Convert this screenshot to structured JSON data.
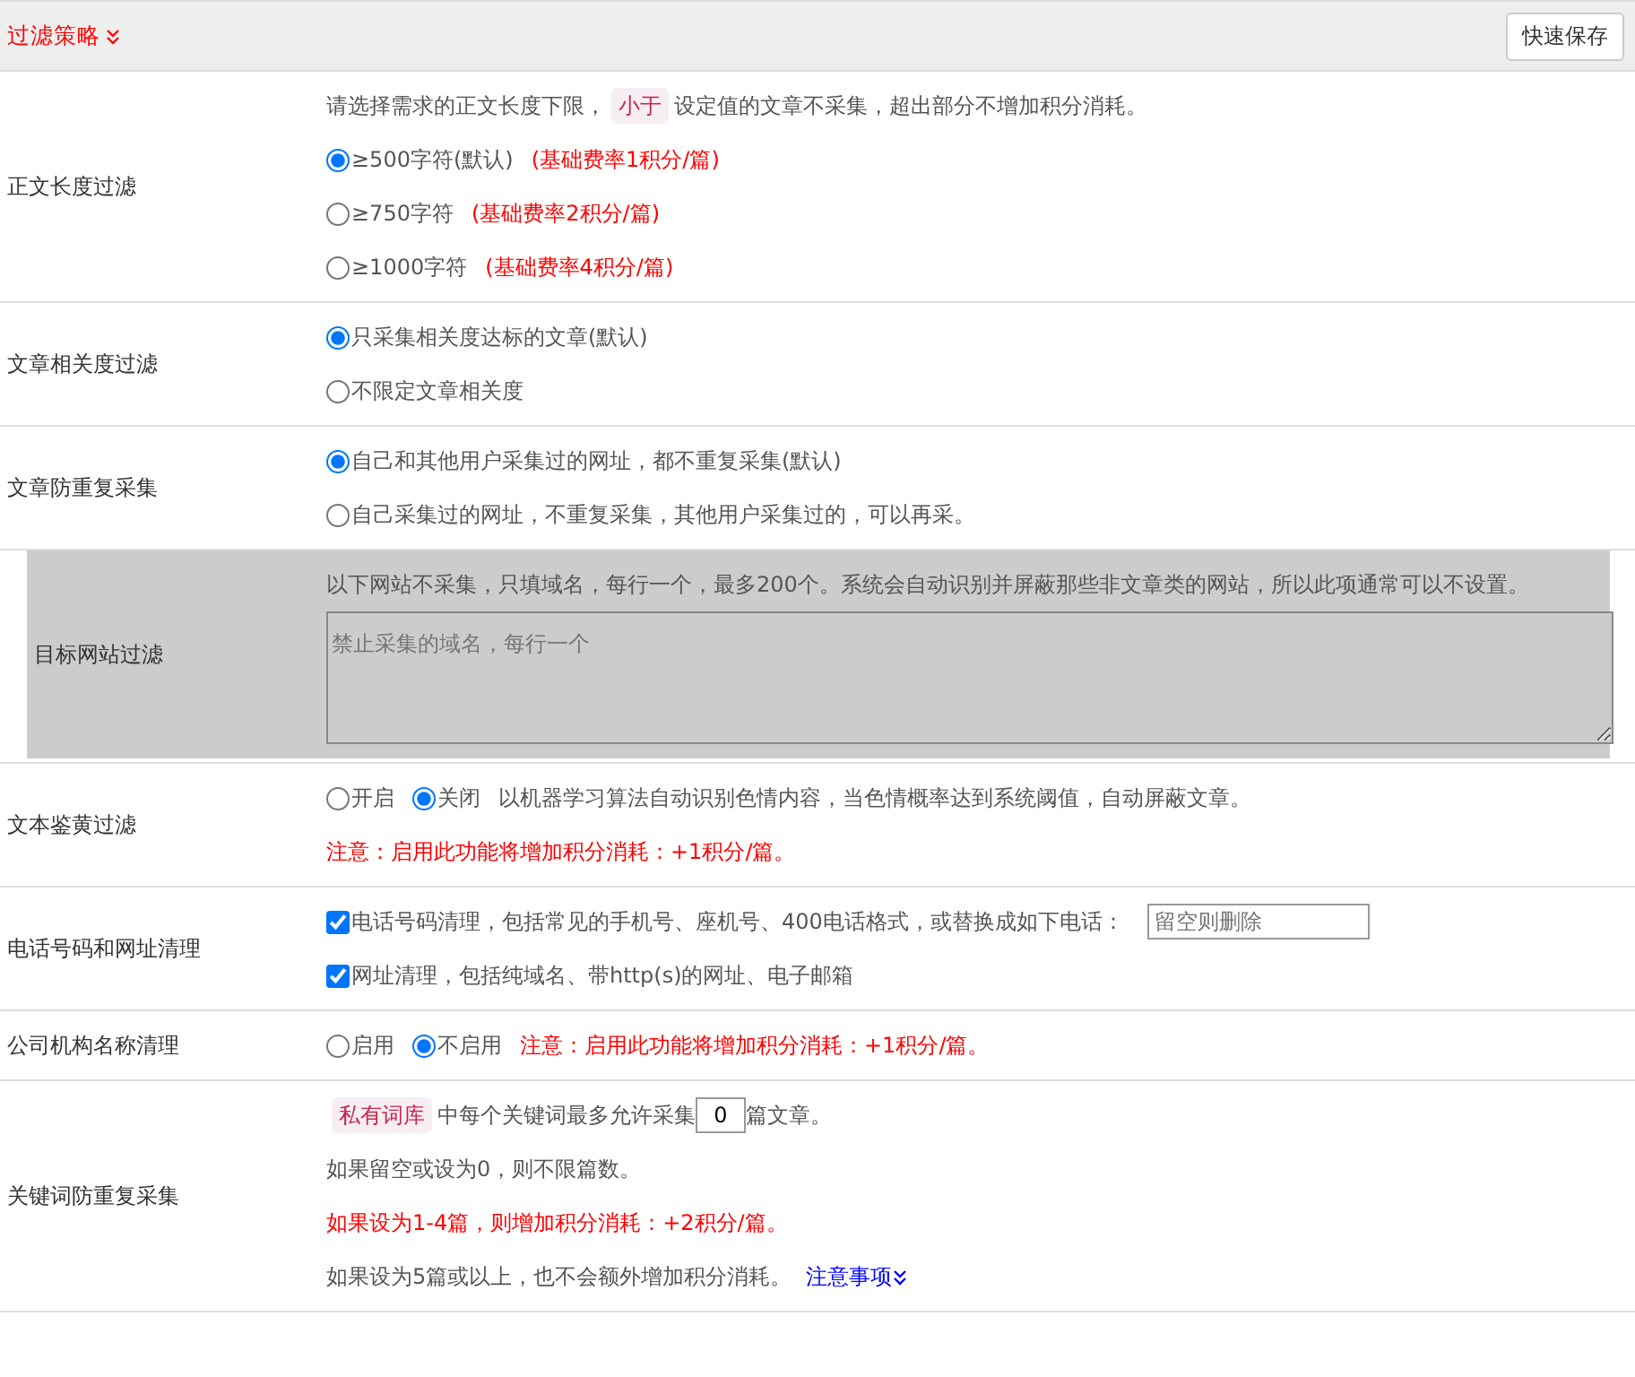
{
  "header": {
    "title": "过滤策略",
    "save_button": "快速保存"
  },
  "rows": [
    {
      "label": "正文长度过滤",
      "highlighted": false,
      "lines": [
        [
          {
            "kind": "text",
            "text": "请选择需求的正文长度下限，"
          },
          {
            "kind": "tag",
            "text": "小于"
          },
          {
            "kind": "text",
            "text": "设定值的文章不采集，超出部分不增加积分消耗。"
          }
        ],
        [
          {
            "kind": "radio",
            "text": "≥500字符(默认)",
            "selected": true
          },
          {
            "kind": "note",
            "text": "(基础费率1积分/篇)"
          }
        ],
        [
          {
            "kind": "radio",
            "text": "≥750字符",
            "selected": false
          },
          {
            "kind": "note",
            "text": "(基础费率2积分/篇)"
          }
        ],
        [
          {
            "kind": "radio",
            "text": "≥1000字符",
            "selected": false
          },
          {
            "kind": "note",
            "text": "(基础费率4积分/篇)"
          }
        ]
      ]
    },
    {
      "label": "文章相关度过滤",
      "highlighted": false,
      "lines": [
        [
          {
            "kind": "radio",
            "text": "只采集相关度达标的文章(默认)",
            "selected": true
          }
        ],
        [
          {
            "kind": "radio",
            "text": "不限定文章相关度",
            "selected": false
          }
        ]
      ]
    },
    {
      "label": "文章防重复采集",
      "highlighted": false,
      "lines": [
        [
          {
            "kind": "radio",
            "text": "自己和其他用户采集过的网址，都不重复采集(默认)",
            "selected": true
          }
        ],
        [
          {
            "kind": "radio",
            "text": "自己采集过的网址，不重复采集，其他用户采集过的，可以再采。",
            "selected": false
          }
        ]
      ]
    },
    {
      "label": "目标网站过滤",
      "highlighted": true,
      "lines": [
        [
          {
            "kind": "text",
            "text": "以下网站不采集，只填域名，每行一个，最多200个。系统会自动识别并屏蔽那些非文章类的网站，所以此项通常可以不设置。"
          }
        ],
        [
          {
            "kind": "textarea",
            "placeholder": "禁止采集的域名，每行一个"
          }
        ]
      ]
    },
    {
      "label": "文本鉴黄过滤",
      "highlighted": false,
      "lines": [
        [
          {
            "kind": "radio",
            "text": "开启",
            "selected": false
          },
          {
            "kind": "radio",
            "text": "关闭",
            "selected": true
          },
          {
            "kind": "text",
            "text": "以机器学习算法自动识别色情内容，当色情概率达到系统阈值，自动屏蔽文章。"
          }
        ],
        [
          {
            "kind": "note",
            "text": "注意：启用此功能将增加积分消耗：+1积分/篇。"
          }
        ]
      ]
    },
    {
      "label": "电话号码和网址清理",
      "highlighted": false,
      "lines": [
        [
          {
            "kind": "checkbox",
            "text": "电话号码清理，包括常见的手机号、座机号、400电话格式，或替换成如下电话：",
            "checked": true
          },
          {
            "kind": "input",
            "placeholder": "留空则删除"
          }
        ],
        [
          {
            "kind": "checkbox",
            "text": "网址清理，包括纯域名、带http(s)的网址、电子邮箱",
            "checked": true
          }
        ]
      ]
    },
    {
      "label": "公司机构名称清理",
      "highlighted": false,
      "lines": [
        [
          {
            "kind": "radio",
            "text": "启用",
            "selected": false
          },
          {
            "kind": "radio",
            "text": "不启用",
            "selected": true
          },
          {
            "kind": "note",
            "text": "注意：启用此功能将增加积分消耗：+1积分/篇。"
          }
        ]
      ]
    },
    {
      "label": "关键词防重复采集",
      "highlighted": false,
      "lines": [
        [
          {
            "kind": "tag",
            "text": "私有词库"
          },
          {
            "kind": "text",
            "text": "中每个关键词最多允许采集"
          },
          {
            "kind": "number",
            "value": "0"
          },
          {
            "kind": "text",
            "text": "篇文章。"
          }
        ],
        [
          {
            "kind": "text",
            "text": "如果留空或设为0，则不限篇数。"
          }
        ],
        [
          {
            "kind": "note",
            "text": "如果设为1-4篇，则增加积分消耗：+2积分/篇。"
          }
        ],
        [
          {
            "kind": "text",
            "text": "如果设为5篇或以上，也不会额外增加积分消耗。"
          },
          {
            "kind": "link",
            "text": "注意事项"
          }
        ]
      ]
    }
  ]
}
